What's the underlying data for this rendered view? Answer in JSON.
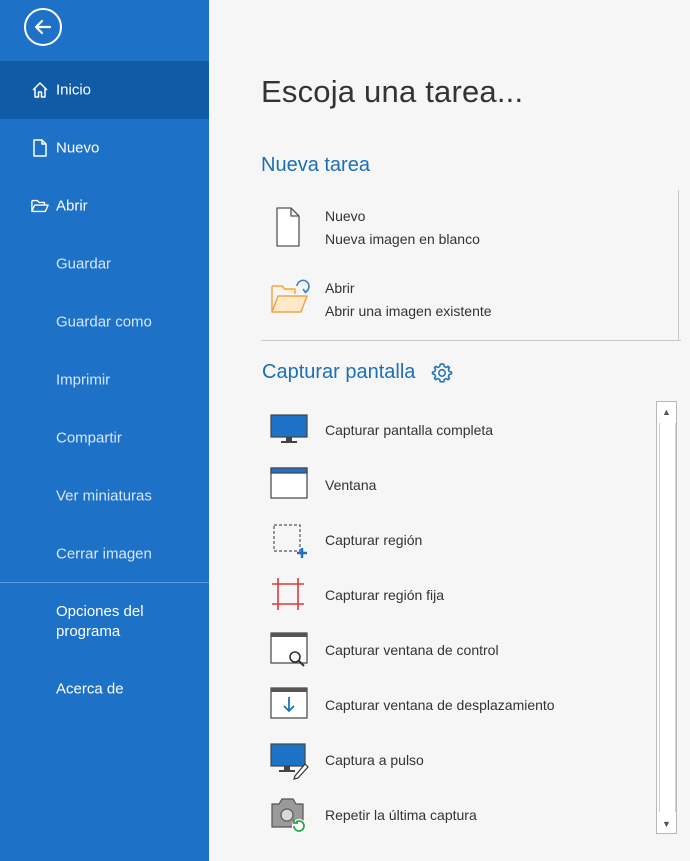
{
  "sidebar": {
    "items": [
      {
        "label": "Inicio"
      },
      {
        "label": "Nuevo"
      },
      {
        "label": "Abrir"
      },
      {
        "label": "Guardar"
      },
      {
        "label": "Guardar como"
      },
      {
        "label": "Imprimir"
      },
      {
        "label": "Compartir"
      },
      {
        "label": "Ver miniaturas"
      },
      {
        "label": "Cerrar imagen"
      },
      {
        "label_line1": "Opciones del",
        "label_line2": "programa"
      },
      {
        "label": "Acerca de"
      }
    ]
  },
  "main": {
    "title": "Escoja una tarea...",
    "new_task": {
      "heading": "Nueva tarea",
      "items": [
        {
          "title": "Nuevo",
          "desc": "Nueva imagen en blanco",
          "icon": "blank-page-icon"
        },
        {
          "title": "Abrir",
          "desc": "Abrir una imagen existente",
          "icon": "open-folder-icon"
        }
      ]
    },
    "capture": {
      "heading": "Capturar pantalla",
      "items": [
        {
          "label": "Capturar pantalla completa",
          "icon": "monitor-icon"
        },
        {
          "label": "Ventana",
          "icon": "window-icon"
        },
        {
          "label": "Capturar región",
          "icon": "region-select-icon"
        },
        {
          "label": "Capturar región fija",
          "icon": "fixed-region-icon"
        },
        {
          "label": "Capturar ventana de control",
          "icon": "window-zoom-icon"
        },
        {
          "label": "Capturar ventana de desplazamiento",
          "icon": "window-scroll-icon"
        },
        {
          "label": "Captura a pulso",
          "icon": "monitor-pen-icon"
        },
        {
          "label": "Repetir la última captura",
          "icon": "camera-repeat-icon"
        }
      ]
    }
  },
  "colors": {
    "sidebar": "#1d72c8",
    "sidebar_active": "#0f5ba5",
    "accent": "#1d6fb8"
  }
}
